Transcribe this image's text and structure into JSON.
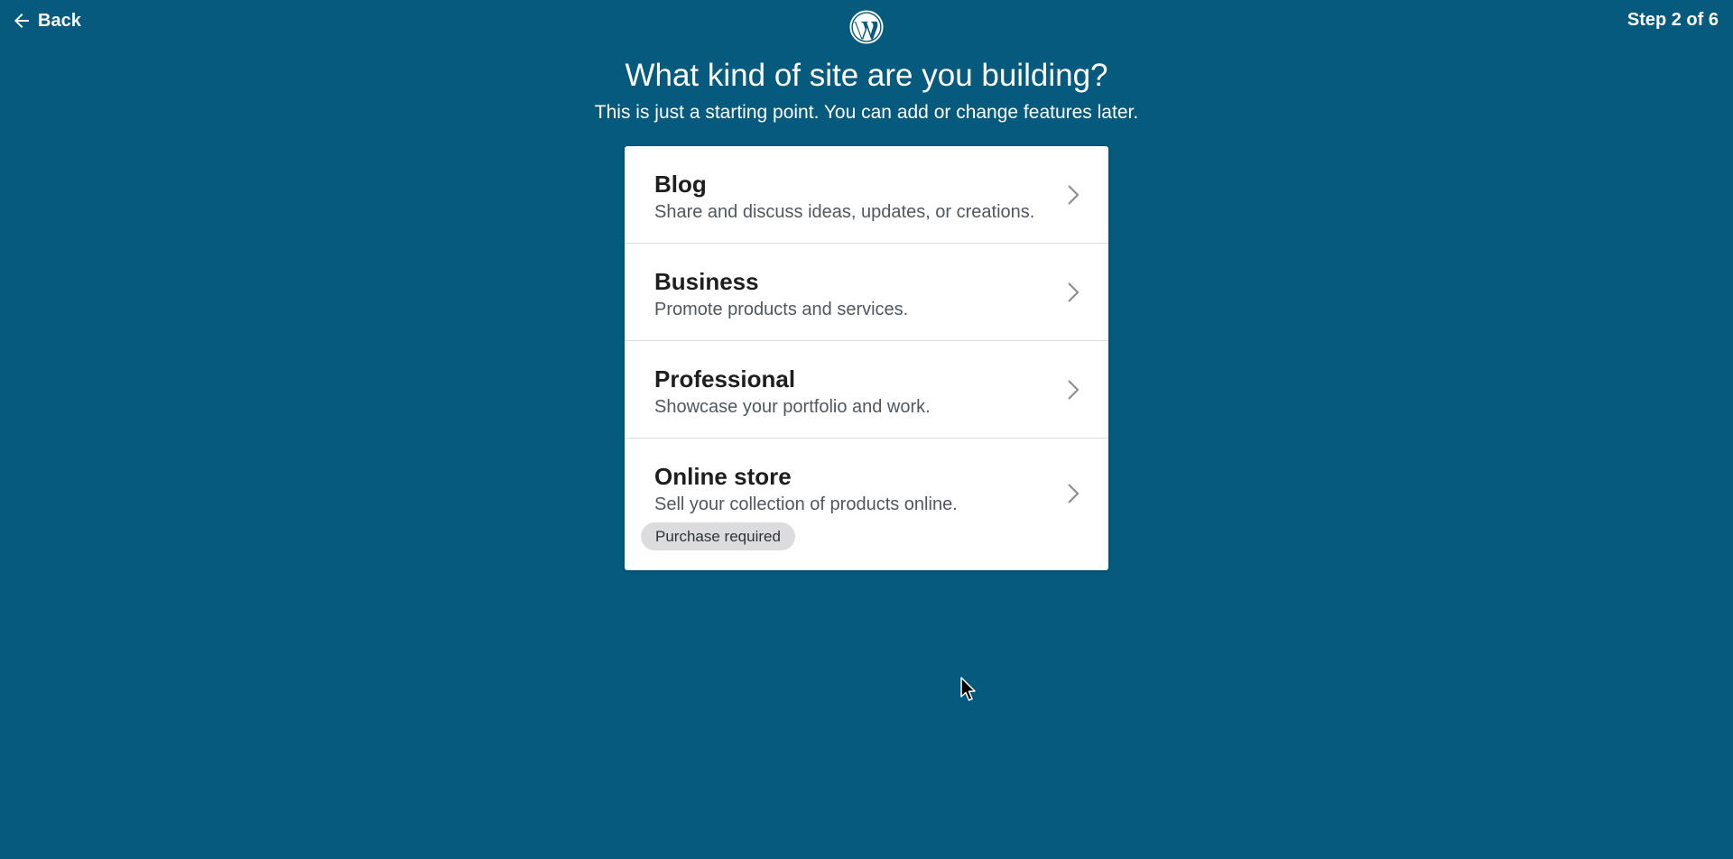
{
  "header": {
    "back_label": "Back",
    "step_label": "Step 2 of 6",
    "logo_icon": "wordpress-logo-icon"
  },
  "intro": {
    "title": "What kind of site are you building?",
    "subtitle": "This is just a starting point. You can add or change features later."
  },
  "options": [
    {
      "title": "Blog",
      "description": "Share and discuss ideas, updates, or creations."
    },
    {
      "title": "Business",
      "description": "Promote products and services."
    },
    {
      "title": "Professional",
      "description": "Showcase your portfolio and work."
    },
    {
      "title": "Online store",
      "description": "Sell your collection of products online.",
      "badge": "Purchase required"
    }
  ],
  "colors": {
    "background": "#055a7d",
    "card": "#ffffff",
    "title_text": "#1e1e1e",
    "description_text": "#50575e",
    "badge_bg": "#dcdcde"
  }
}
